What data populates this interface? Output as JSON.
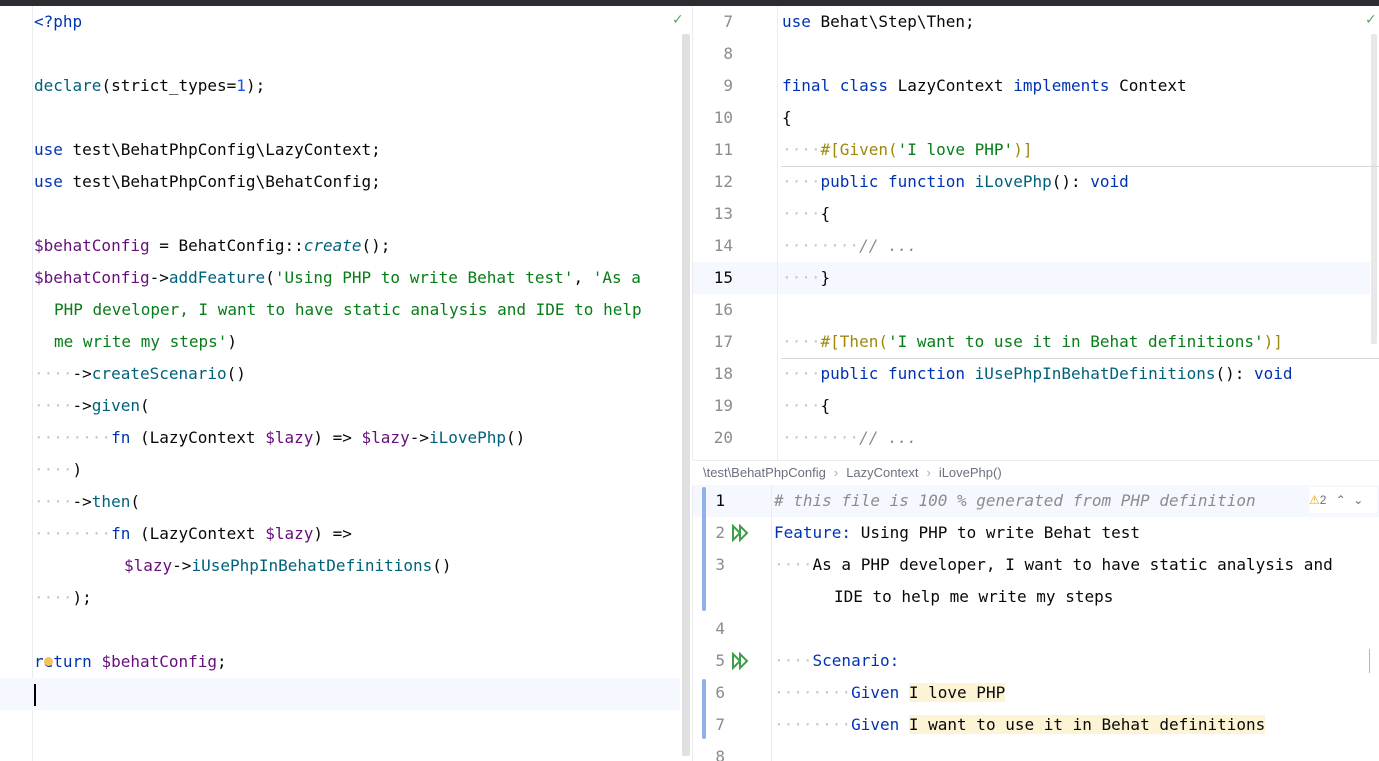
{
  "left_editor": {
    "lines": [
      "<?php",
      "",
      "declare(strict_types=1);",
      "",
      "use test\\BehatPhpConfig\\LazyContext;",
      "use test\\BehatPhpConfig\\BehatConfig;",
      "",
      "$behatConfig = BehatConfig::create();",
      "$behatConfig->addFeature('Using PHP to write Behat test', 'As a",
      "PHP developer, I want to have static analysis and IDE to help",
      "me write my steps')",
      "->createScenario()",
      "->given(",
      "fn (LazyContext $lazy) => $lazy->iLovePhp()",
      ")",
      "->then(",
      "fn (LazyContext $lazy) =>",
      "$lazy->iUsePhpInBehatDefinitions()",
      ");",
      "",
      "return $behatConfig;"
    ]
  },
  "right_editor": {
    "line_numbers": [
      "7",
      "8",
      "9",
      "10",
      "11",
      "12",
      "13",
      "14",
      "15",
      "16",
      "17",
      "18",
      "19",
      "20"
    ],
    "lines": [
      "use Behat\\Step\\Then;",
      "",
      "final class LazyContext implements Context",
      "{",
      "#[Given('I love PHP')]",
      "public function iLovePhp(): void",
      "{",
      "// ...",
      "}",
      "",
      "#[Then('I want to use it in Behat definitions')]",
      "public function iUsePhpInBehatDefinitions(): void",
      "{",
      "// ..."
    ],
    "current_line": "15"
  },
  "breadcrumb": {
    "items": [
      "\\test\\BehatPhpConfig",
      "LazyContext",
      "iLovePhp()"
    ]
  },
  "feature_editor": {
    "line_numbers": [
      "1",
      "2",
      "3",
      "",
      "4",
      "5",
      "6",
      "7",
      "8"
    ],
    "lines": [
      "# this file is 100 % generated from PHP definition",
      "Feature: Using PHP to write Behat test",
      "As a PHP developer, I want to have static analysis and",
      "IDE to help me write my steps",
      "",
      "Scenario:",
      "Given I love PHP",
      "Given I want to use it in Behat definitions"
    ],
    "warning_count": "2"
  }
}
